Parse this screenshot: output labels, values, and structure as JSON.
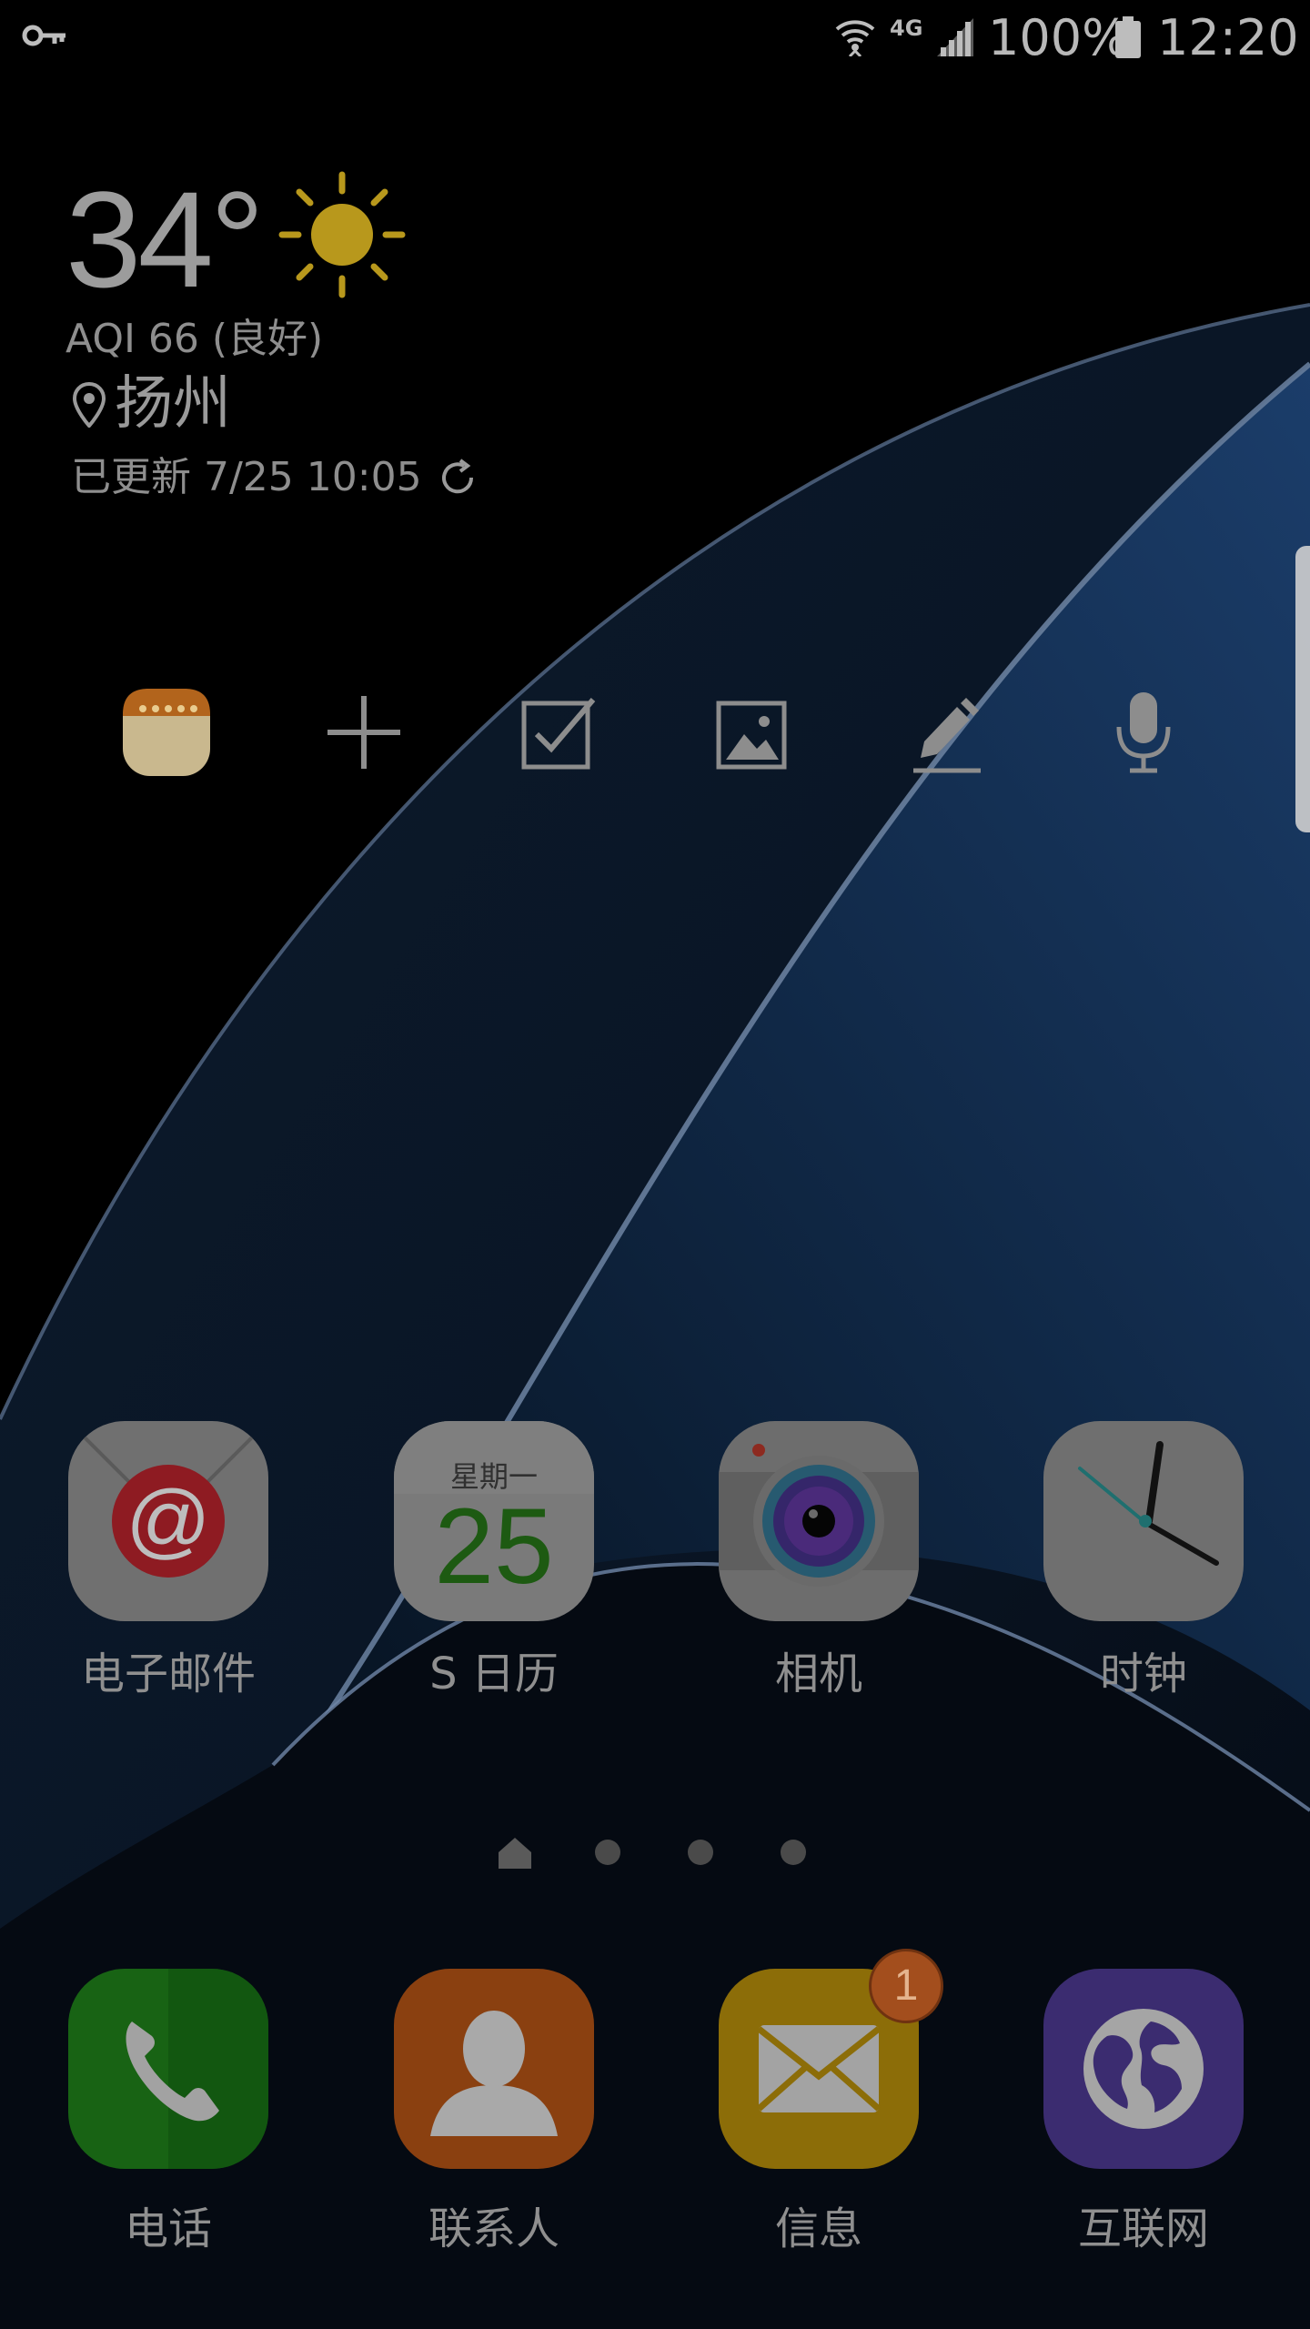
{
  "status_bar": {
    "network": "4G",
    "battery": "100%",
    "time": "12:20"
  },
  "weather": {
    "temperature": "34°",
    "aqi": "AQI 66 (良好)",
    "city": "扬州",
    "updated": "已更新 7/25 10:05"
  },
  "quick_tools": {
    "items": [
      "memo-icon",
      "add-icon",
      "checklist-icon",
      "image-icon",
      "pen-icon",
      "voice-recorder-icon"
    ]
  },
  "apps": {
    "email": {
      "label": "电子邮件"
    },
    "calendar": {
      "label": "S 日历",
      "weekday": "星期一",
      "day": "25"
    },
    "camera": {
      "label": "相机"
    },
    "clock": {
      "label": "时钟"
    }
  },
  "dock": {
    "phone": {
      "label": "电话"
    },
    "contacts": {
      "label": "联系人"
    },
    "messages": {
      "label": "信息",
      "badge": "1"
    },
    "internet": {
      "label": "互联网"
    }
  },
  "page_indicator": {
    "pages": 4,
    "current": 1
  }
}
